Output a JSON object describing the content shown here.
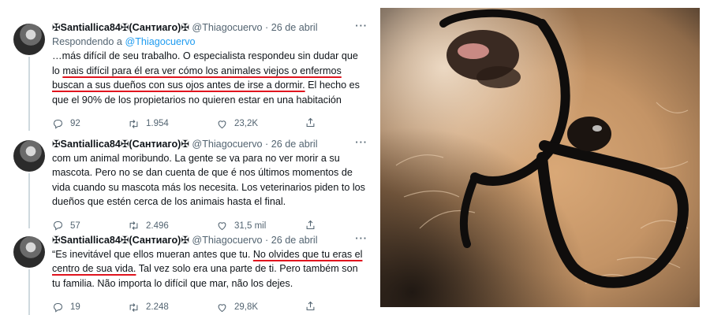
{
  "tweets": [
    {
      "name": "✠Santiallica84✠(Сантиаго)✠",
      "handle": "@Thiagocuervo",
      "date": "26 de abril",
      "reply_prefix": "Respondendo a ",
      "reply_to": "@Thiagocuervo",
      "text_parts": [
        "…más difícil de seu trabalho. O especialista respondeu sin dudar que lo ",
        "mais difícil para él era ver cómo los animales viejos o enfermos buscan a sus dueños con sus ojos antes de irse a dormir.",
        " El hecho es que el 90% de los propietarios no quieren estar en una habitación"
      ],
      "replies": "92",
      "retweets": "1.954",
      "likes": "23,2K"
    },
    {
      "name": "✠Santiallica84✠(Сантиаго)✠",
      "handle": "@Thiagocuervo",
      "date": "26 de abril",
      "text": "com um animal moribundo. La gente se va para no ver morir a su mascota. Pero no se dan cuenta de que é nos últimos momentos de vida cuando su mascota más los necesita. Los veterinarios piden to los dueños que estén cerca de los animais hasta el final.",
      "replies": "57",
      "retweets": "2.496",
      "likes": "31,5 mil"
    },
    {
      "name": "✠Santiallica84✠(Сантиаго)✠",
      "handle": "@Thiagocuervo",
      "date": "26 de abril",
      "text_parts": [
        "“Es inevitável que ellos mueran antes que tu. ",
        "No olvides que tu eras el centro de sua vida.",
        " Tal vez solo era una parte de ti. Pero também son tu familia. Não importa lo difícil que mar, não los dejes."
      ],
      "replies": "19",
      "retweets": "2.248",
      "likes": "29,8K"
    }
  ],
  "icons": {
    "more": "more-options-icon",
    "reply": "reply-icon",
    "retweet": "retweet-icon",
    "like": "heart-icon",
    "share": "share-icon"
  },
  "photo": {
    "subject": "dog-with-glasses-photo"
  },
  "colors": {
    "link": "#1d9bf0",
    "underline": "#e0141e",
    "muted": "#536471"
  }
}
